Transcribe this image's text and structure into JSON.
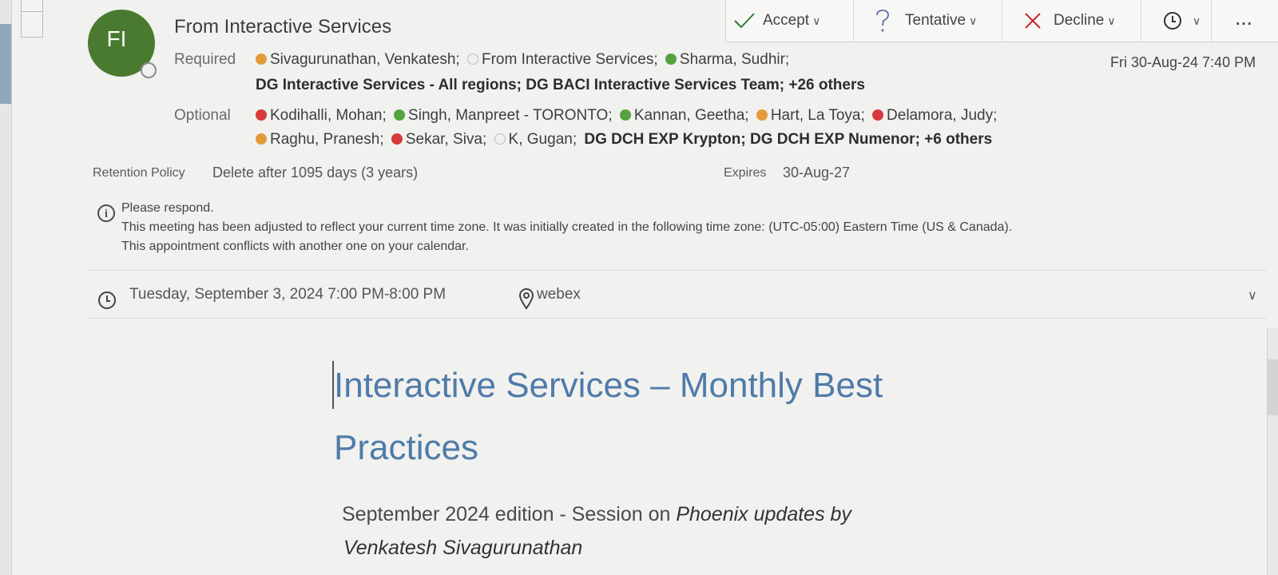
{
  "header": {
    "avatar_initials": "FI",
    "sender": "From Interactive Services",
    "date": "Fri 30-Aug-24 7:40 PM"
  },
  "toolbar": {
    "accept": "Accept",
    "tentative": "Tentative",
    "decline": "Decline",
    "more": "..."
  },
  "attendees": {
    "required_label": "Required",
    "required_line1": [
      {
        "name": "Sivagurunathan, Venkatesh;",
        "status": "orange"
      },
      {
        "name": "From Interactive Services;",
        "status": "empty"
      },
      {
        "name": "Sharma, Sudhir;",
        "status": "green"
      }
    ],
    "required_line2": "DG Interactive Services - All regions; DG BACI Interactive Services Team; +26 others",
    "optional_label": "Optional",
    "optional_line1": [
      {
        "name": "Kodihalli, Mohan;",
        "status": "red"
      },
      {
        "name": "Singh, Manpreet - TORONTO;",
        "status": "green"
      },
      {
        "name": "Kannan, Geetha;",
        "status": "green"
      },
      {
        "name": "Hart, La Toya;",
        "status": "orange"
      },
      {
        "name": "Delamora, Judy;",
        "status": "red"
      }
    ],
    "optional_line2_people": [
      {
        "name": "Raghu, Pranesh;",
        "status": "orange"
      },
      {
        "name": "Sekar, Siva;",
        "status": "red"
      },
      {
        "name": "K, Gugan;",
        "status": "empty"
      }
    ],
    "optional_line2_groups": "DG DCH EXP Krypton; DG DCH EXP Numenor; +6 others"
  },
  "retention": {
    "label": "Retention Policy",
    "value": "Delete after 1095 days (3 years)",
    "expires_label": "Expires",
    "expires_value": "30-Aug-27"
  },
  "notice": {
    "title": "Please respond.",
    "line1": "This meeting has been adjusted to reflect your current time zone. It was initially created in the following time zone: (UTC-05:00) Eastern Time (US & Canada).",
    "line2": "This appointment conflicts with another one on your calendar."
  },
  "meeting": {
    "when": "Tuesday, September 3, 2024 7:00 PM-8:00 PM",
    "location": "webex"
  },
  "body": {
    "heading": "Interactive Services – Monthly Best Practices",
    "subtitle_prefix": "September 2024 edition - Session on ",
    "subtitle_italic": "Phoenix updates by",
    "subtitle_line2": "Venkatesh Sivagurunathan"
  },
  "colors": {
    "accept_check": "#2e7d32",
    "tentative": "#5b6fa8",
    "decline": "#c62828",
    "heading": "#4f7ba8",
    "avatar_bg": "#4a7a30"
  }
}
